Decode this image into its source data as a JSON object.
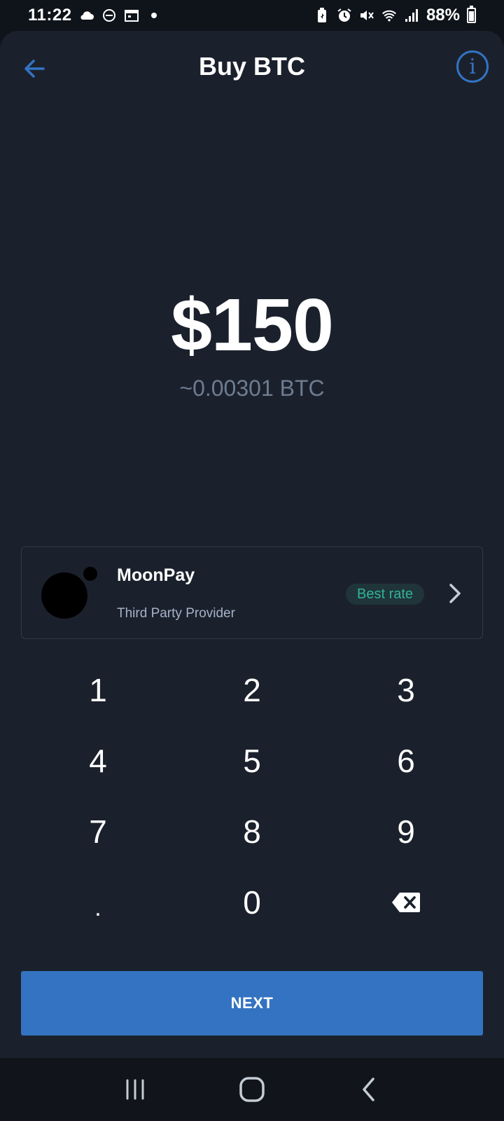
{
  "status_bar": {
    "time": "11:22",
    "battery_percent": "88%"
  },
  "header": {
    "title": "Buy BTC",
    "info_label": "i"
  },
  "amount": {
    "fiat": "$150",
    "crypto": "~0.00301 BTC"
  },
  "provider": {
    "name": "MoonPay",
    "subtitle": "Third Party Provider",
    "badge": "Best rate"
  },
  "keypad": {
    "keys": [
      "1",
      "2",
      "3",
      "4",
      "5",
      "6",
      "7",
      "8",
      "9",
      ".",
      "0"
    ]
  },
  "actions": {
    "next_label": "NEXT"
  },
  "colors": {
    "accent": "#3373c1",
    "badge_text": "#33b39a",
    "background": "#1b212c"
  }
}
